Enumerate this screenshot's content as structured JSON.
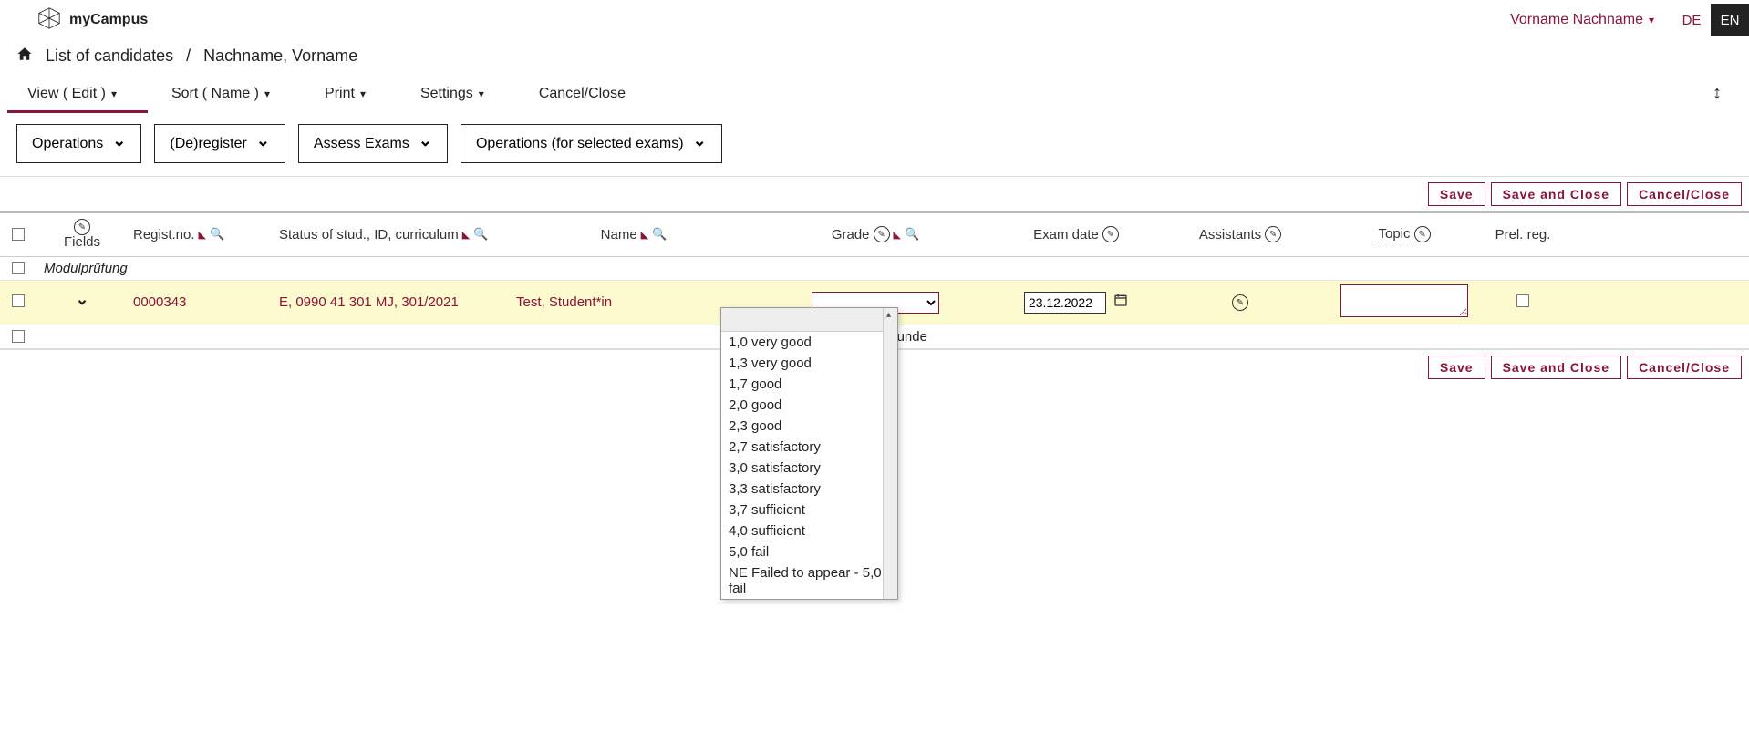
{
  "brand": "myCampus",
  "user": "Vorname Nachname",
  "lang": {
    "de": "DE",
    "en": "EN"
  },
  "breadcrumb": {
    "list": "List of candidates",
    "sep": "/",
    "person": "Nachname, Vorname"
  },
  "menu": {
    "view": "View ( Edit )",
    "sort": "Sort ( Name )",
    "print": "Print",
    "settings": "Settings",
    "cancel": "Cancel/Close"
  },
  "actions": {
    "operations": "Operations",
    "deregister": "(De)register",
    "assess": "Assess Exams",
    "ops_selected": "Operations (for selected exams)"
  },
  "buttons": {
    "save": "Save",
    "save_close": "Save and Close",
    "cancel_close": "Cancel/Close"
  },
  "headers": {
    "fields": "Fields",
    "regist": "Regist.no.",
    "status": "Status of stud., ID, curriculum",
    "name": "Name",
    "grade": "Grade",
    "examdate": "Exam date",
    "assistants": "Assistants",
    "topic": "Topic",
    "prel": "Prel. reg."
  },
  "group": "Modulprüfung",
  "row": {
    "regist": "0000343",
    "status": "E, 0990 41 301 MJ, 301/2021",
    "name": "Test, Student*in",
    "grade": "",
    "date": "23.12.2022",
    "topic": ""
  },
  "footer": ",1 Sekunde",
  "grade_options": [
    "1,0 very good",
    "1,3 very good",
    "1,7 good",
    "2,0 good",
    "2,3 good",
    "2,7 satisfactory",
    "3,0 satisfactory",
    "3,3 satisfactory",
    "3,7 sufficient",
    "4,0 sufficient",
    "5,0 fail",
    "NE Failed to appear - 5,0 fail"
  ]
}
